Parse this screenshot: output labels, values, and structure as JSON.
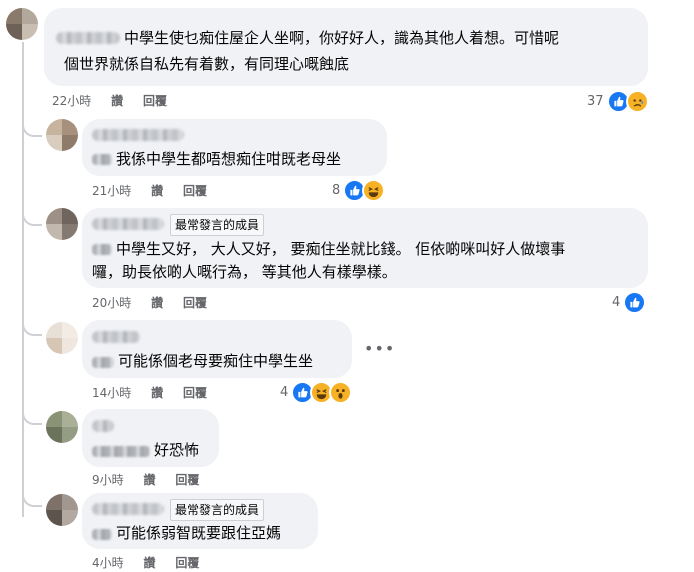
{
  "comments": [
    {
      "text_lines": [
        "中學生使乜痴住屋企人坐啊，你好好人，識為其他人着想。可惜呢",
        "個世界就係自私先有着數，有同理心嘅蝕底"
      ],
      "time": "22小時",
      "like_action": "讚",
      "reply_action": "回覆",
      "reaction_count": "37",
      "reactions": [
        "like-icon",
        "sad-icon"
      ]
    },
    {
      "text_lines": [
        "我係中學生都唔想痴住咁既老母坐"
      ],
      "time": "21小時",
      "like_action": "讚",
      "reply_action": "回覆",
      "reaction_count": "8",
      "reactions": [
        "like-icon",
        "haha-icon"
      ]
    },
    {
      "badge": "最常發言的成員",
      "text_lines": [
        "中學生又好， 大人又好， 要痴住坐就比錢。 佢依啲咪叫好人做壞事",
        "囉，助長依啲人嘅行為， 等其他人有樣學樣。"
      ],
      "time": "20小時",
      "like_action": "讚",
      "reply_action": "回覆",
      "reaction_count": "4",
      "reactions": [
        "like-icon"
      ]
    },
    {
      "text_lines": [
        "可能係個老母要痴住中學生坐"
      ],
      "time": "14小時",
      "like_action": "讚",
      "reply_action": "回覆",
      "reaction_count": "4",
      "reactions": [
        "like-icon",
        "haha-icon",
        "wow-icon"
      ],
      "more_label": "•••"
    },
    {
      "text_lines": [
        "好恐怖"
      ],
      "time": "9小時",
      "like_action": "讚",
      "reply_action": "回覆"
    },
    {
      "badge": "最常發言的成員",
      "text_lines": [
        "可能係弱智既要跟住亞媽"
      ],
      "time": "4小時",
      "like_action": "讚",
      "reply_action": "回覆"
    }
  ],
  "colors": {
    "bubble": "#f0f2f5",
    "meta": "#65676b",
    "like_blue": "#1877f2",
    "emoji_yellow": "#f7b125"
  }
}
